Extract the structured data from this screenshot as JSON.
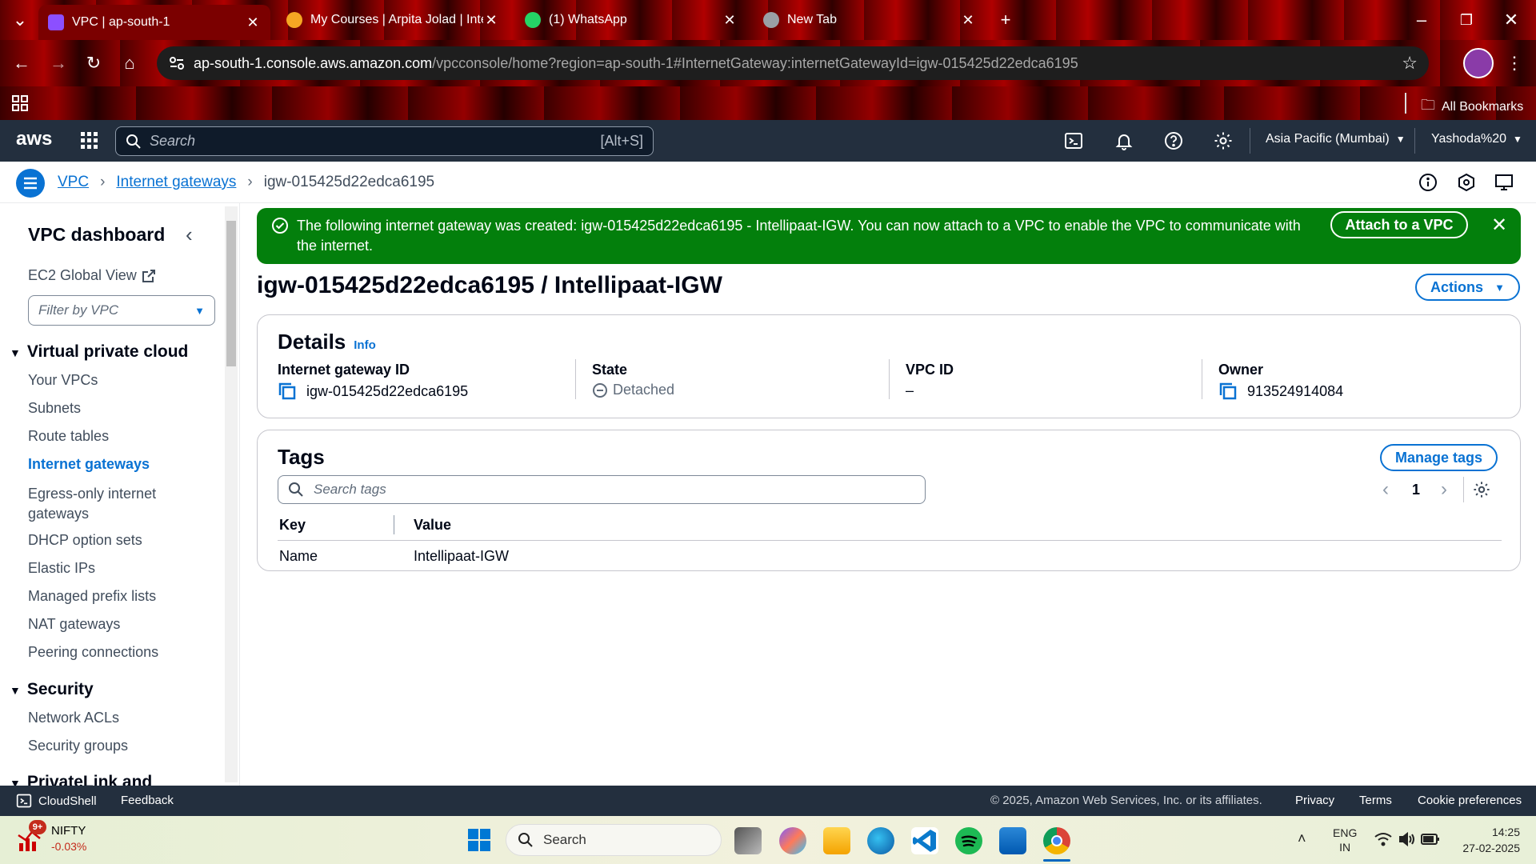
{
  "browser": {
    "tabs": [
      {
        "title": "VPC | ap-south-1",
        "active": true
      },
      {
        "title": "My Courses | Arpita Jolad | Intel",
        "active": false
      },
      {
        "title": "(1) WhatsApp",
        "active": false
      },
      {
        "title": "New Tab",
        "active": false
      }
    ],
    "url_host": "ap-south-1.console.aws.amazon.com",
    "url_path": "/vpcconsole/home?region=ap-south-1#InternetGateway:internetGatewayId=igw-015425d22edca6195",
    "bookmarks_label": "All Bookmarks"
  },
  "aws_header": {
    "logo": "aws",
    "search_placeholder": "Search",
    "search_shortcut": "[Alt+S]",
    "region": "Asia Pacific (Mumbai)",
    "account": "Yashoda%20"
  },
  "breadcrumb": {
    "items": [
      "VPC",
      "Internet gateways",
      "igw-015425d22edca6195"
    ]
  },
  "sidenav": {
    "title": "VPC dashboard",
    "ec2_global_view": "EC2 Global View",
    "filter_placeholder": "Filter by VPC",
    "sections": [
      {
        "title": "Virtual private cloud",
        "items": [
          "Your VPCs",
          "Subnets",
          "Route tables",
          "Internet gateways",
          "Egress-only internet gateways",
          "DHCP option sets",
          "Elastic IPs",
          "Managed prefix lists",
          "NAT gateways",
          "Peering connections"
        ]
      },
      {
        "title": "Security",
        "items": [
          "Network ACLs",
          "Security groups"
        ]
      },
      {
        "title": "PrivateLink and",
        "items": []
      }
    ],
    "active_item": "Internet gateways"
  },
  "banner": {
    "message": "The following internet gateway was created: igw-015425d22edca6195 - Intellipaat-IGW. You can now attach to a VPC to enable the VPC to communicate with the internet.",
    "action_label": "Attach to a VPC",
    "color": "#037f0c"
  },
  "page": {
    "title": "igw-015425d22edca6195 / Intellipaat-IGW",
    "actions_label": "Actions"
  },
  "details": {
    "heading": "Details",
    "info_link": "Info",
    "fields": [
      {
        "label": "Internet gateway ID",
        "value": "igw-015425d22edca6195"
      },
      {
        "label": "State",
        "value": "Detached"
      },
      {
        "label": "VPC ID",
        "value": "–"
      },
      {
        "label": "Owner",
        "value": "913524914084"
      }
    ]
  },
  "tags": {
    "heading": "Tags",
    "manage_label": "Manage tags",
    "search_placeholder": "Search tags",
    "page_number": "1",
    "columns": [
      "Key",
      "Value"
    ],
    "rows": [
      {
        "key": "Name",
        "value": "Intellipaat-IGW"
      }
    ]
  },
  "footer": {
    "cloudshell": "CloudShell",
    "feedback": "Feedback",
    "copyright": "© 2025, Amazon Web Services, Inc. or its affiliates.",
    "links": [
      "Privacy",
      "Terms",
      "Cookie preferences"
    ]
  },
  "taskbar": {
    "stock_name": "NIFTY",
    "stock_change": "-0.03%",
    "stock_badge": "9+",
    "search_label": "Search",
    "lang_top": "ENG",
    "lang_bottom": "IN",
    "time": "14:25",
    "date": "27-02-2025"
  }
}
